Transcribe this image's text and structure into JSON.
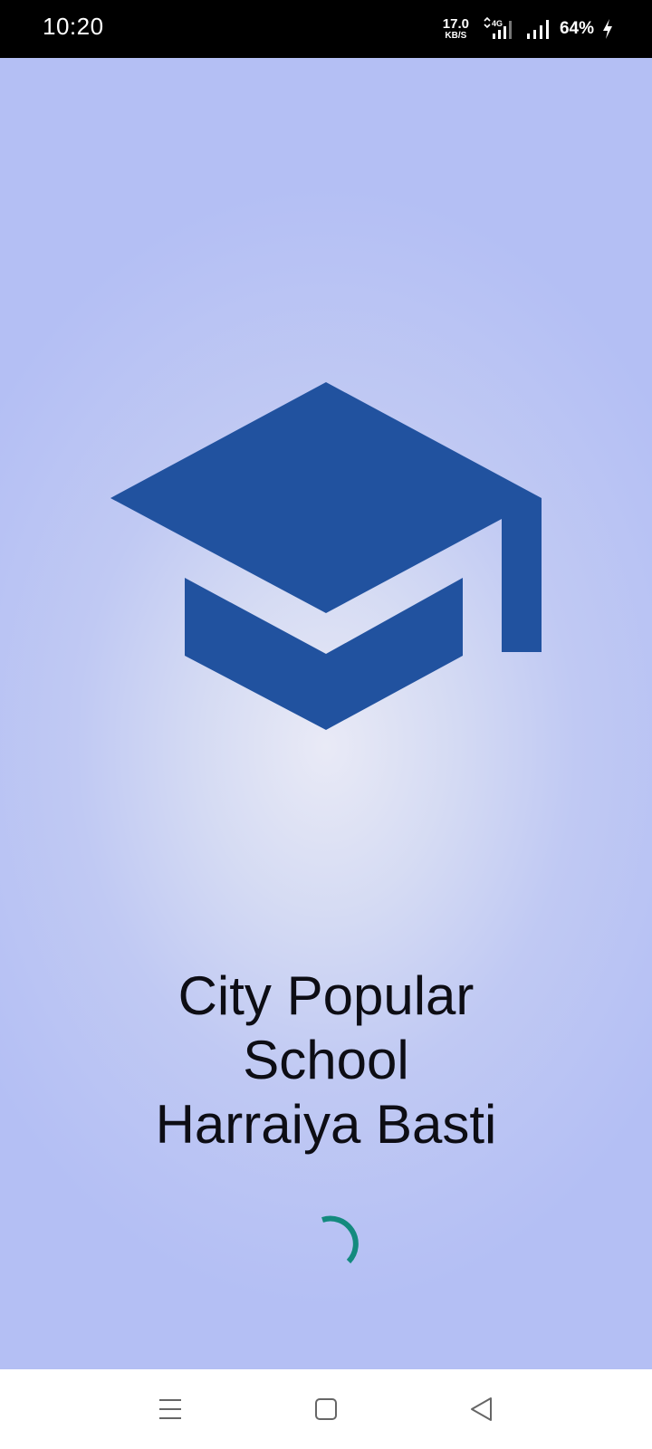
{
  "status_bar": {
    "time": "10:20",
    "net_speed_value": "17.0",
    "net_speed_unit": "KB/S",
    "network_type": "4G",
    "battery_percent": "64%",
    "icons": [
      "data-arrows-icon",
      "signal-4g-icon",
      "signal-icon",
      "charging-bolt-icon"
    ]
  },
  "splash": {
    "logo_icon": "graduation-cap-icon",
    "school_name_line1": "City Popular",
    "school_name_line2": "School",
    "school_name_line3": "Harraiya Basti",
    "loading_indicator": "spinner-icon"
  },
  "nav_bar": {
    "buttons": [
      "menu-icon",
      "home-icon",
      "back-icon"
    ]
  },
  "colors": {
    "status_bar_bg": "#000000",
    "background": "#b4bef4",
    "logo": "#21529f",
    "spinner": "#138a7e",
    "text": "#0d0d14",
    "nav_bar_bg": "#ffffff"
  }
}
